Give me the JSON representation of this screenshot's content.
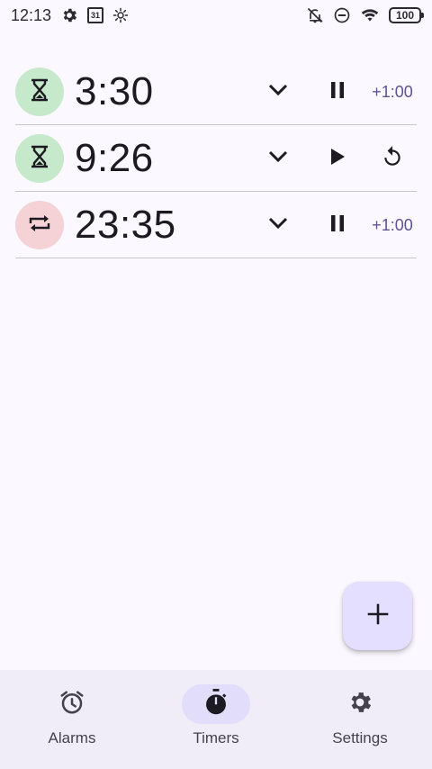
{
  "status_bar": {
    "time": "12:13",
    "calendar_day": "31",
    "battery": "100"
  },
  "timers": [
    {
      "type_icon": "hourglass-icon",
      "time": "3:30",
      "state": "running",
      "extra": "+1:00",
      "badge_color": "#c6e9cb"
    },
    {
      "type_icon": "hourglass-icon",
      "time": "9:26",
      "state": "paused",
      "extra": "reset",
      "badge_color": "#c6e9cb"
    },
    {
      "type_icon": "repeat-icon",
      "time": "23:35",
      "state": "running",
      "extra": "+1:00",
      "badge_color": "#f5d2d6"
    }
  ],
  "fab": {
    "icon": "plus-icon"
  },
  "nav": {
    "items": [
      {
        "label": "Alarms",
        "icon": "alarm-clock-icon",
        "active": false
      },
      {
        "label": "Timers",
        "icon": "stopwatch-icon",
        "active": true
      },
      {
        "label": "Settings",
        "icon": "gear-icon",
        "active": false
      }
    ]
  },
  "colors": {
    "background": "#fcf8ff",
    "accent_text": "#5a5496",
    "fab": "#e4dfff",
    "nav_bg": "#f0ecf8",
    "nav_active": "#e2ddfb"
  }
}
